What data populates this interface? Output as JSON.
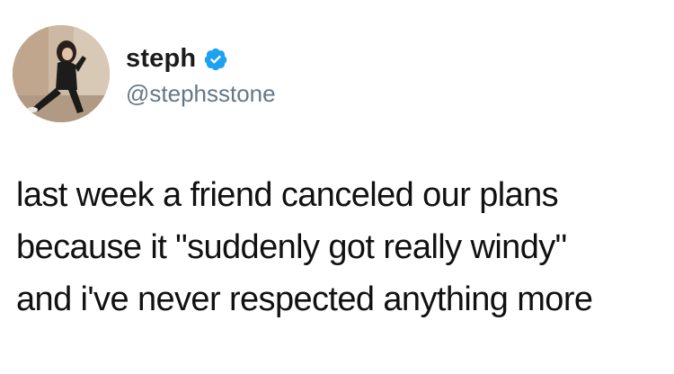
{
  "user": {
    "display_name": "steph",
    "handle": "@stephsstone",
    "verified": true,
    "verified_color": "#1da1f2"
  },
  "tweet": {
    "lines": [
      "last week a friend canceled our plans",
      "because it \"suddenly got really windy\"",
      "and i've never respected anything more"
    ]
  },
  "icons": {
    "avatar": "avatar",
    "verified": "verified-badge-icon"
  }
}
